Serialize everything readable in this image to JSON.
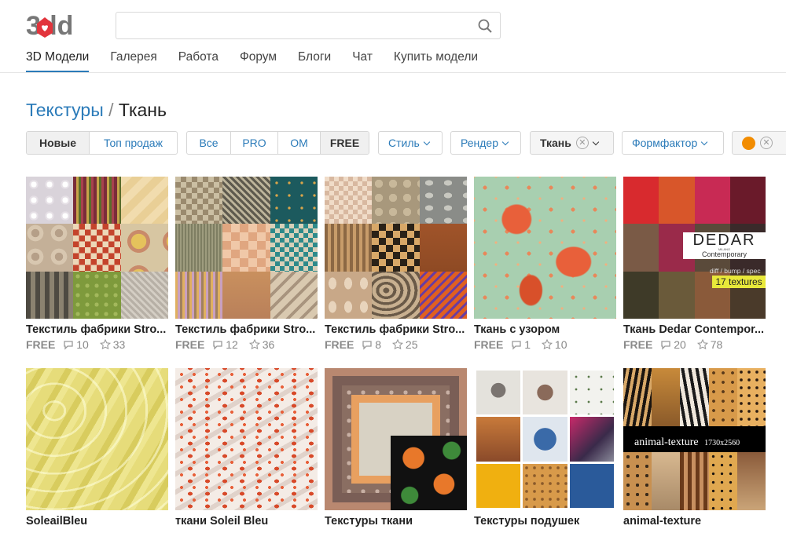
{
  "header": {
    "logo_text": "3dd",
    "search_placeholder": "",
    "nav": [
      "3D Модели",
      "Галерея",
      "Работа",
      "Форум",
      "Блоги",
      "Чат",
      "Купить модели"
    ]
  },
  "breadcrumb": {
    "parent": "Текстуры",
    "separator": " / ",
    "current": "Ткань"
  },
  "filters": {
    "sort": [
      "Новые",
      "Топ продаж"
    ],
    "access": [
      "Все",
      "PRO",
      "OM",
      "FREE"
    ],
    "style": "Стиль",
    "render": "Рендер",
    "material": "Ткань",
    "formfactor": "Формфактор",
    "color": "#f28c00"
  },
  "items": [
    {
      "title": "Текстиль фабрики Stro...",
      "free": "FREE",
      "comments": "10",
      "stars": "33"
    },
    {
      "title": "Текстиль фабрики Stro...",
      "free": "FREE",
      "comments": "12",
      "stars": "36"
    },
    {
      "title": "Текстиль фабрики Stro...",
      "free": "FREE",
      "comments": "8",
      "stars": "25"
    },
    {
      "title": "Ткань с узором",
      "free": "FREE",
      "comments": "1",
      "stars": "10"
    },
    {
      "title": "Ткань Dedar Contempor...",
      "free": "FREE",
      "comments": "20",
      "stars": "78"
    },
    {
      "title": "SoleailBleu"
    },
    {
      "title": "ткани Soleil Bleu"
    },
    {
      "title": "Текстуры ткани"
    },
    {
      "title": "Текстуры подушек"
    },
    {
      "title": "animal-texture"
    }
  ],
  "thumb_text": {
    "dedar_brand": "DEDAR",
    "dedar_city": "MILANO",
    "dedar_line": "Contemporary",
    "dedar_maps": "diff / bump / spec",
    "dedar_count": "17 textures",
    "animal_label": "animal-texture",
    "animal_size": "1730x2560"
  }
}
